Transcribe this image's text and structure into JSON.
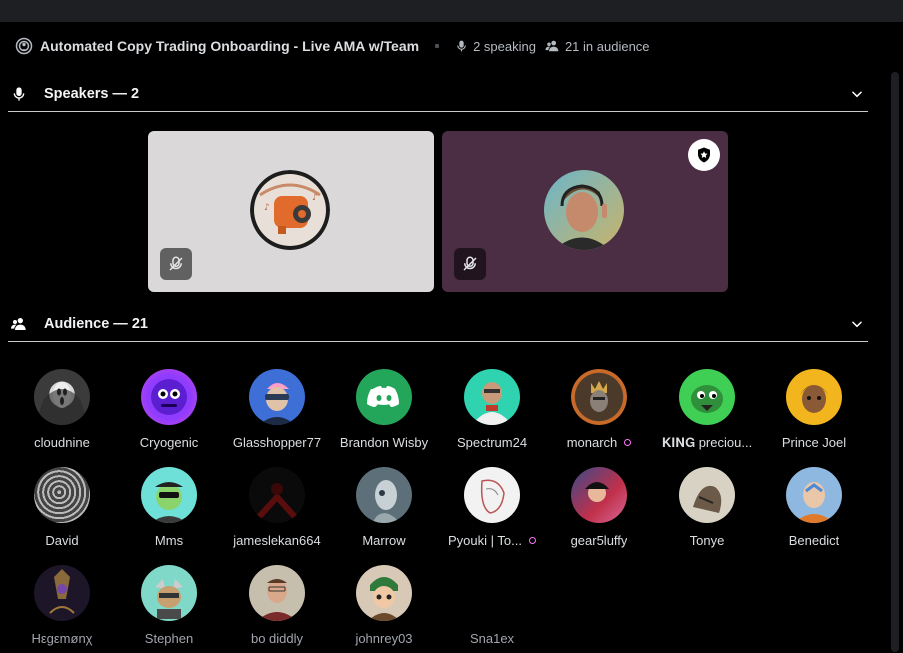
{
  "stage": {
    "title": "Automated Copy Trading Onboarding - Live AMA w/Team",
    "speaking": "2 speaking",
    "audience_count": "21 in audience"
  },
  "speakers": {
    "heading": "Speakers — 2",
    "tiles": [
      {
        "bg": "#dad8d8",
        "muted": true,
        "moderator": false
      },
      {
        "bg": "#4b2e43",
        "muted": true,
        "moderator": true
      }
    ]
  },
  "audience": {
    "heading": "Audience — 21",
    "members": [
      {
        "name": "cloudnine",
        "boost": false
      },
      {
        "name": "Cryogenic",
        "boost": false
      },
      {
        "name": "Glasshopper77",
        "boost": false
      },
      {
        "name": "Brandon Wisby",
        "boost": false
      },
      {
        "name": "Spectrum24",
        "boost": false
      },
      {
        "name": "monarch",
        "boost": true
      },
      {
        "name": "𝐊𝐈𝐍𝐆 preciou...",
        "boost": false
      },
      {
        "name": "Prince Joel",
        "boost": false
      },
      {
        "name": "David",
        "boost": false
      },
      {
        "name": "Mms",
        "boost": false
      },
      {
        "name": "jameslekan664",
        "boost": false
      },
      {
        "name": "Marrow",
        "boost": false
      },
      {
        "name": "Pyouki | To...",
        "boost": true
      },
      {
        "name": "gear5luffy",
        "boost": false
      },
      {
        "name": "Tonye",
        "boost": false
      },
      {
        "name": "Benedict",
        "boost": false
      },
      {
        "name": "Hεgεmønχ",
        "boost": false
      },
      {
        "name": "Stephen",
        "boost": false
      },
      {
        "name": "bo diddly",
        "boost": false
      },
      {
        "name": "johnrey03",
        "boost": false
      },
      {
        "name": "Sna1ex",
        "boost": false
      }
    ]
  },
  "colors": {
    "background": "#000000",
    "divider": "#c9cbcf",
    "discord_blurple": "#5865f2",
    "discord_green": "#23a55a",
    "boost_pink": "#ff73fa"
  },
  "icons": {
    "stage": "stage-channel-icon",
    "mic": "microphone-icon",
    "people": "people-icon",
    "chevron": "chevron-down-icon",
    "muted": "mic-muted-icon",
    "moderator": "stage-moderator-icon"
  }
}
